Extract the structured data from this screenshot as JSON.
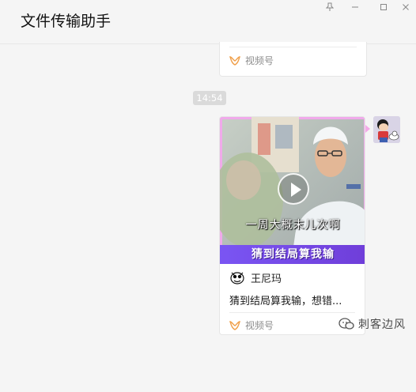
{
  "window": {
    "title": "文件传输助手",
    "buttons": [
      "pin-icon",
      "minimize-icon",
      "maximize-icon",
      "close-icon"
    ]
  },
  "messages": {
    "prev_card": {
      "source_label": "视频号"
    },
    "time": "14:54",
    "video_card": {
      "subtitle": "一周大概末儿次啊",
      "banner": "猜到结局算我输",
      "author": "王尼玛",
      "description": "猜到结局算我输，想错...",
      "source_label": "视频号"
    }
  },
  "watermark": {
    "text": "刺客边风"
  },
  "colors": {
    "background": "#f5f5f5",
    "accent_orange": "#f0a04b",
    "banner_purple": "#7a55f3",
    "bubble_pink": "#f4a9e8"
  }
}
